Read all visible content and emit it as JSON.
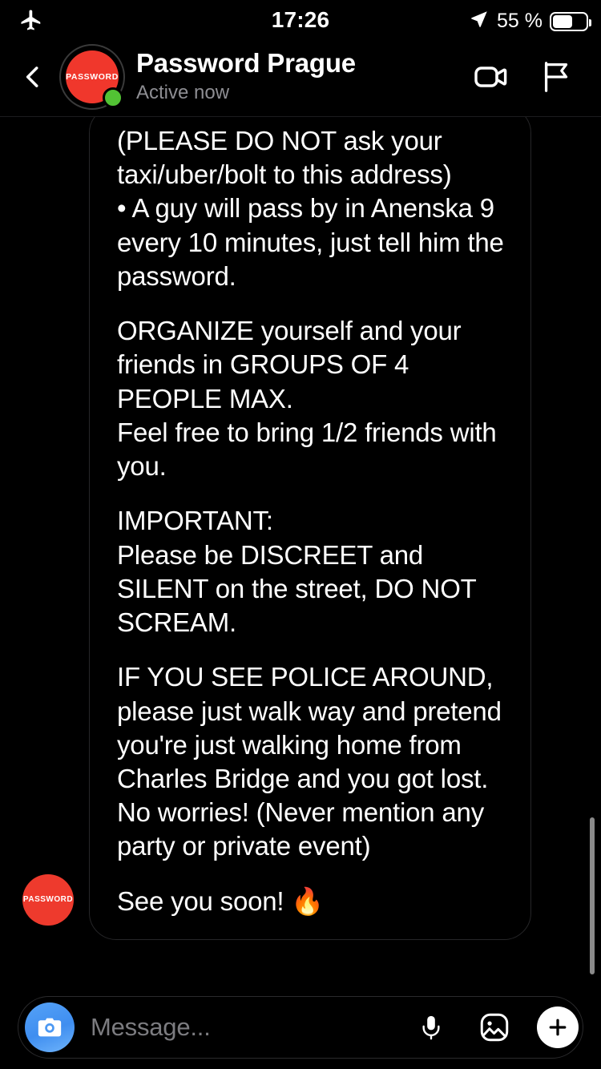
{
  "status_bar": {
    "airplane_icon": "airplane-mode-icon",
    "time": "17:26",
    "location_icon": "location-arrow-icon",
    "battery_percent": "55 %",
    "battery_level": 55
  },
  "header": {
    "back_icon": "chevron-left-icon",
    "avatar_label": "PASSWORD",
    "title": "Password Prague",
    "subtitle": "Active now",
    "video_call_icon": "video-camera-icon",
    "flag_icon": "flag-icon",
    "presence": "online"
  },
  "thread": {
    "message": {
      "sender_avatar_label": "PASSWORD",
      "paragraphs": [
        "(PLEASE DO NOT ask your taxi/uber/bolt to this address)\n• A guy will pass by in Anenska 9 every 10 minutes, just tell him the password.",
        "ORGANIZE yourself and your friends in GROUPS OF 4 PEOPLE MAX.\nFeel free to bring 1/2 friends with you.",
        "IMPORTANT:\nPlease be DISCREET and SILENT on the street, DO NOT SCREAM.",
        "IF YOU SEE POLICE AROUND, please just walk way and pretend you're just walking home from Charles Bridge and you got lost. No worries! (Never mention any party or private event)",
        "See you soon! 🔥"
      ]
    },
    "scrollbar": "vertical-scrollbar"
  },
  "composer": {
    "camera_icon": "camera-icon",
    "placeholder": "Message...",
    "mic_icon": "microphone-icon",
    "gallery_icon": "photo-gallery-icon",
    "plus_icon": "plus-icon"
  },
  "colors": {
    "background": "#000000",
    "accent_red": "#f0372c",
    "presence_green": "#52c234",
    "camera_blue": "#3f8ef0",
    "secondary_text": "#8e8e93",
    "bubble_border": "#262628"
  }
}
